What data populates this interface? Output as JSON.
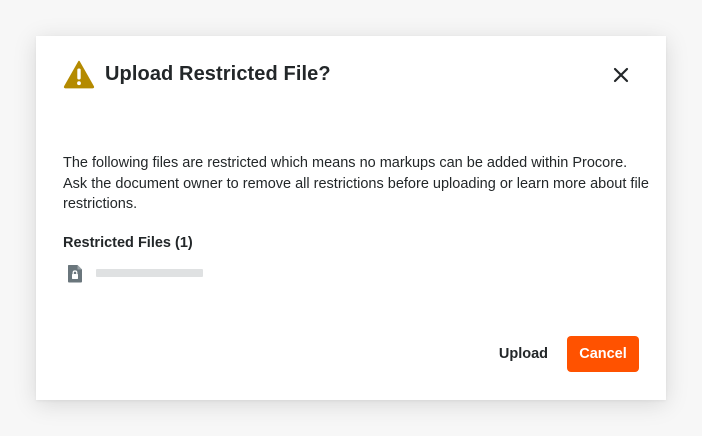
{
  "dialog": {
    "title": "Upload Restricted File?",
    "title_icon": "warning-triangle-icon",
    "close_icon": "close-icon",
    "message": "The following files are restricted which means no markups can be added within Procore. Ask the document owner to remove all restrictions before uploading or learn more about file restrictions.",
    "section_title": "Restricted Files (1)",
    "files": [
      {
        "icon": "locked-file-icon",
        "name": ""
      }
    ],
    "buttons": {
      "upload_label": "Upload",
      "cancel_label": "Cancel"
    }
  },
  "colors": {
    "accent": "#ff5200",
    "warning": "#b48a00",
    "text": "#232729",
    "file_icon": "#6a767c",
    "placeholder_bar": "#dfe1e2"
  }
}
